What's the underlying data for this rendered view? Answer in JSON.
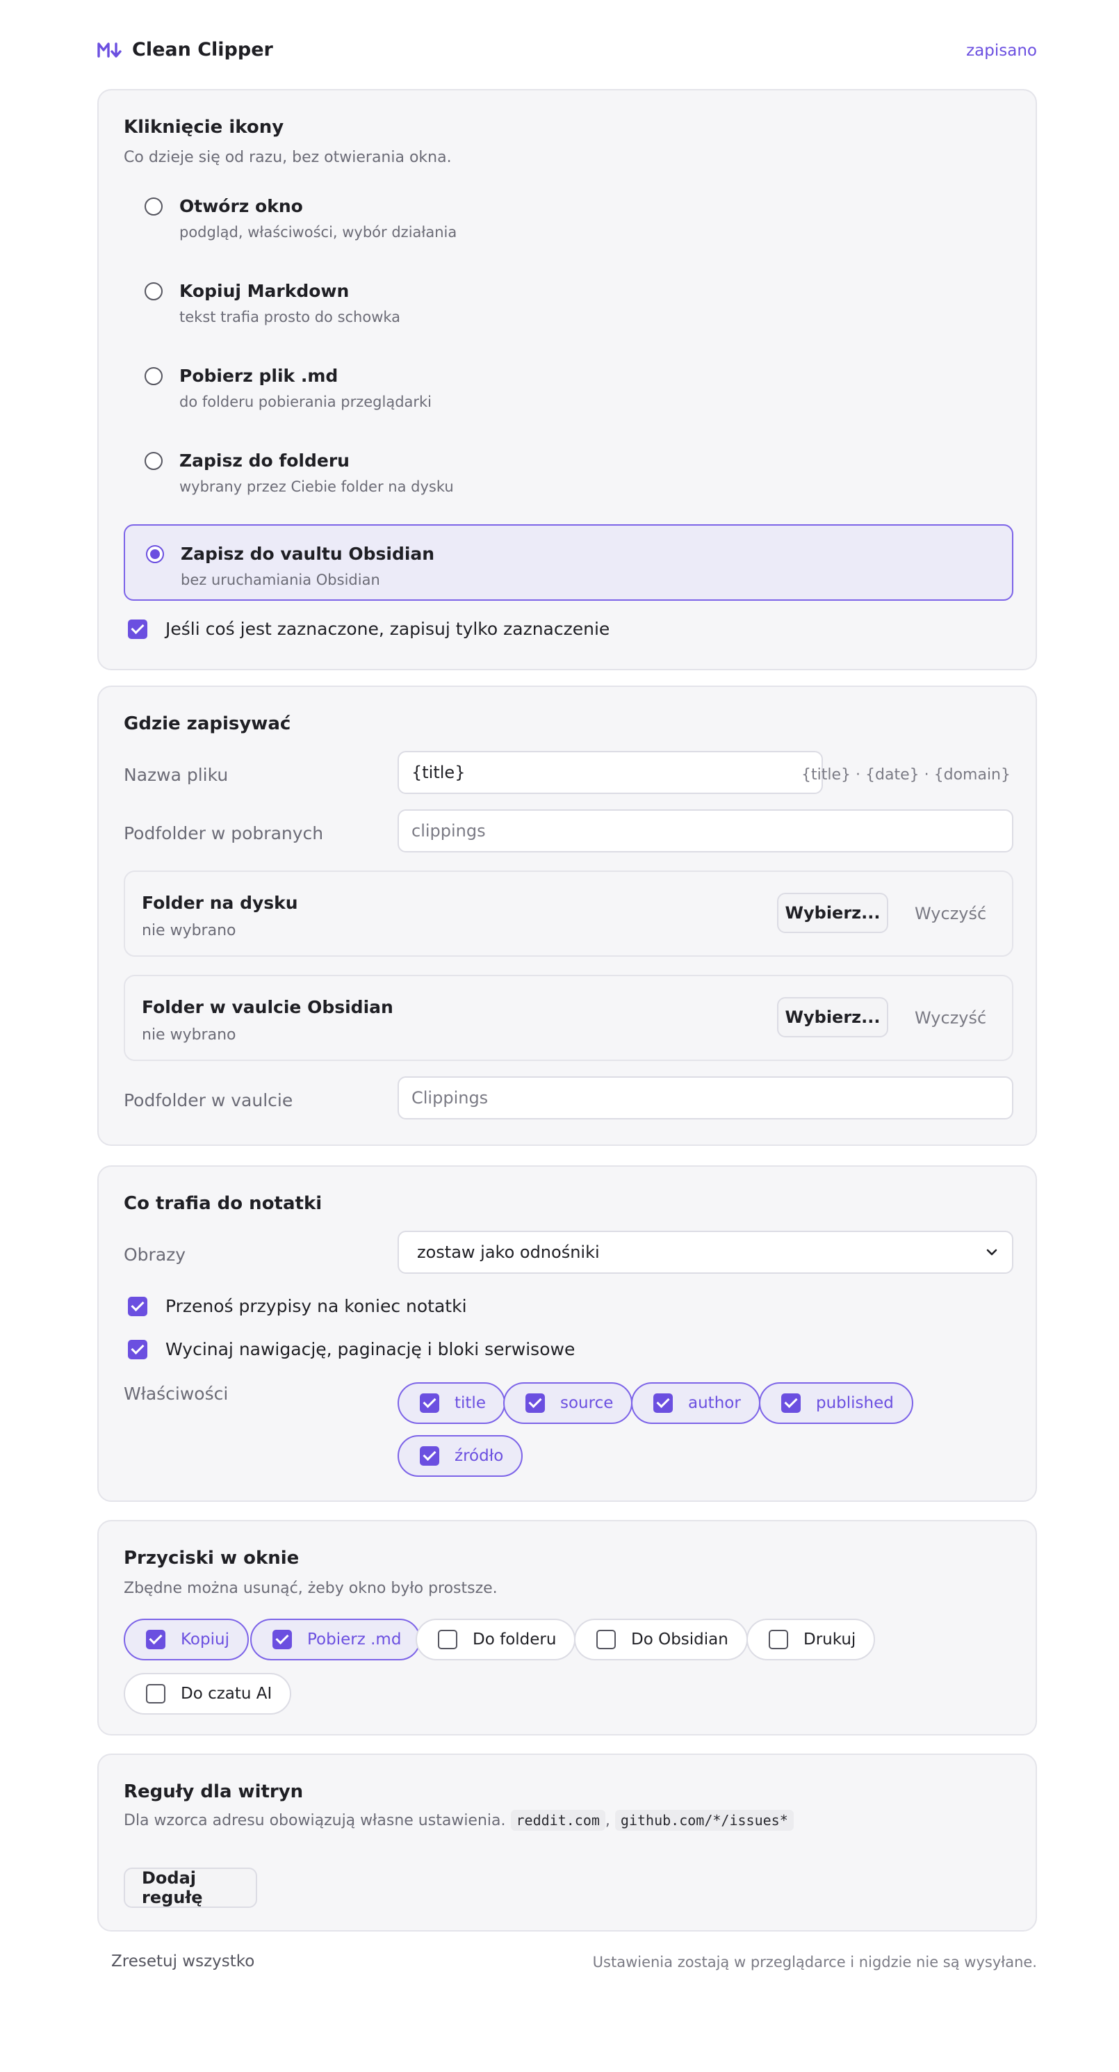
{
  "header": {
    "app_name": "Clean Clipper",
    "status": "zapisano",
    "logo_icon": "markdown-down-arrow-icon",
    "accent": "#6b4fe0"
  },
  "icon_click": {
    "title": "Kliknięcie ikony",
    "desc": "Co dzieje się od razu, bez otwierania okna.",
    "options": [
      {
        "label": "Otwórz okno",
        "sub": "podgląd, właściwości, wybór działania",
        "selected": false
      },
      {
        "label": "Kopiuj Markdown",
        "sub": "tekst trafia prosto do schowka",
        "selected": false
      },
      {
        "label": "Pobierz plik .md",
        "sub": "do folderu pobierania przeglądarki",
        "selected": false
      },
      {
        "label": "Zapisz do folderu",
        "sub": "wybrany przez Ciebie folder na dysku",
        "selected": false
      },
      {
        "label": "Zapisz do vaultu Obsidian",
        "sub": "bez uruchamiania Obsidian",
        "selected": true
      }
    ],
    "selection_only_label": "Jeśli coś jest zaznaczone, zapisuj tylko zaznaczenie"
  },
  "where": {
    "title": "Gdzie zapisywać",
    "filename_label": "Nazwa pliku",
    "filename_value": "{title}",
    "filename_hint": "{title} · {date} · {domain}",
    "download_subfolder_label": "Podfolder w pobranych",
    "download_subfolder_placeholder": "clippings",
    "disk_folder": {
      "title": "Folder na dysku",
      "status": "nie wybrano",
      "choose": "Wybierz...",
      "clear": "Wyczyść"
    },
    "vault_folder": {
      "title": "Folder w vaulcie Obsidian",
      "status": "nie wybrano",
      "choose": "Wybierz...",
      "clear": "Wyczyść"
    },
    "vault_subfolder_label": "Podfolder w vaulcie",
    "vault_subfolder_placeholder": "Clippings"
  },
  "content": {
    "title": "Co trafia do notatki",
    "images_label": "Obrazy",
    "images_value": "zostaw jako odnośniki",
    "footnotes_label": "Przenoś przypisy na koniec notatki",
    "strip_label": "Wycinaj nawigację, paginację i bloki serwisowe",
    "properties_label": "Właściwości",
    "properties": [
      "title",
      "source",
      "author",
      "published",
      "źródło"
    ]
  },
  "buttons": {
    "title": "Przyciski w oknie",
    "desc": "Zbędne można usunąć, żeby okno było prostsze.",
    "items": [
      {
        "label": "Kopiuj",
        "on": true
      },
      {
        "label": "Pobierz .md",
        "on": true
      },
      {
        "label": "Do folderu",
        "on": false
      },
      {
        "label": "Do Obsidian",
        "on": false
      },
      {
        "label": "Drukuj",
        "on": false
      },
      {
        "label": "Do czatu AI",
        "on": false
      }
    ]
  },
  "rules": {
    "title": "Reguły dla witryn",
    "desc": "Dla wzorca adresu obowiązują własne ustawienia.",
    "example1": "reddit.com",
    "sep": ",",
    "example2": "github.com/*/issues*",
    "add_button": "Dodaj regułę"
  },
  "footer": {
    "reset": "Zresetuj wszystko",
    "note": "Ustawienia zostają w przeglądarce i nigdzie nie są wysyłane."
  }
}
